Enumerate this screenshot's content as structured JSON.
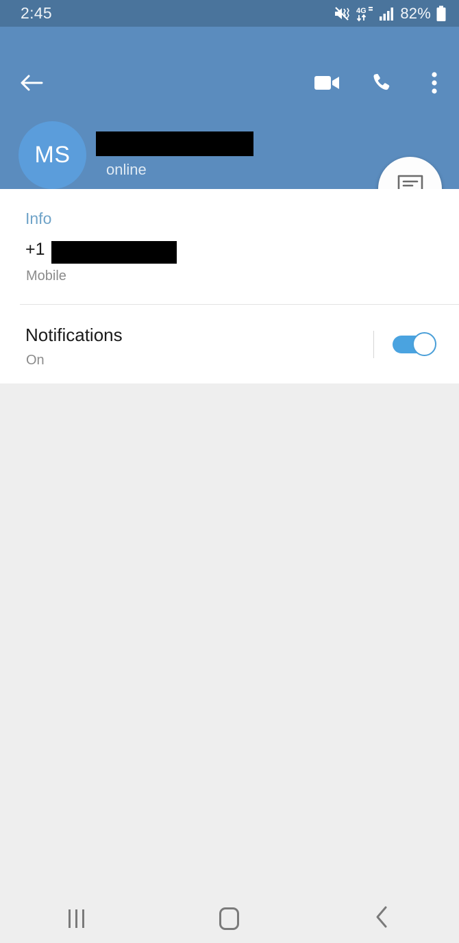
{
  "status_bar": {
    "time": "2:45",
    "battery_percent": "82%",
    "icons": [
      "mute-icon",
      "4g-lte-data-icon",
      "signal-bars-icon",
      "battery-icon"
    ],
    "background_color": "#4a749c"
  },
  "header": {
    "background_color": "#5b8cbe",
    "back_icon": "back-arrow-icon",
    "actions": [
      {
        "name": "video-call-button",
        "icon": "video-camera-icon"
      },
      {
        "name": "voice-call-button",
        "icon": "phone-handset-icon"
      },
      {
        "name": "overflow-menu-button",
        "icon": "three-dot-menu-icon"
      }
    ],
    "avatar": {
      "initials": "MS",
      "background_color": "#5b9ddb"
    },
    "contact_name": "",
    "contact_name_redacted": true,
    "presence": "online"
  },
  "fab": {
    "icon": "message-bubble-icon",
    "label": ""
  },
  "info_card": {
    "section_title": "Info",
    "section_title_color": "#6fa3c8",
    "phone": {
      "prefix": "+1",
      "number": "",
      "number_redacted": true,
      "type": "Mobile"
    },
    "notifications": {
      "title": "Notifications",
      "state_label": "On",
      "toggle_on": true,
      "toggle_color": "#4aa3e0"
    }
  },
  "nav_bar": {
    "items": [
      {
        "name": "recents-button",
        "icon": "recents-icon"
      },
      {
        "name": "home-button",
        "icon": "home-icon"
      },
      {
        "name": "back-button",
        "icon": "chevron-left-icon"
      }
    ],
    "background_color": "#eeeeee"
  },
  "body_background_color": "#eeeeee"
}
